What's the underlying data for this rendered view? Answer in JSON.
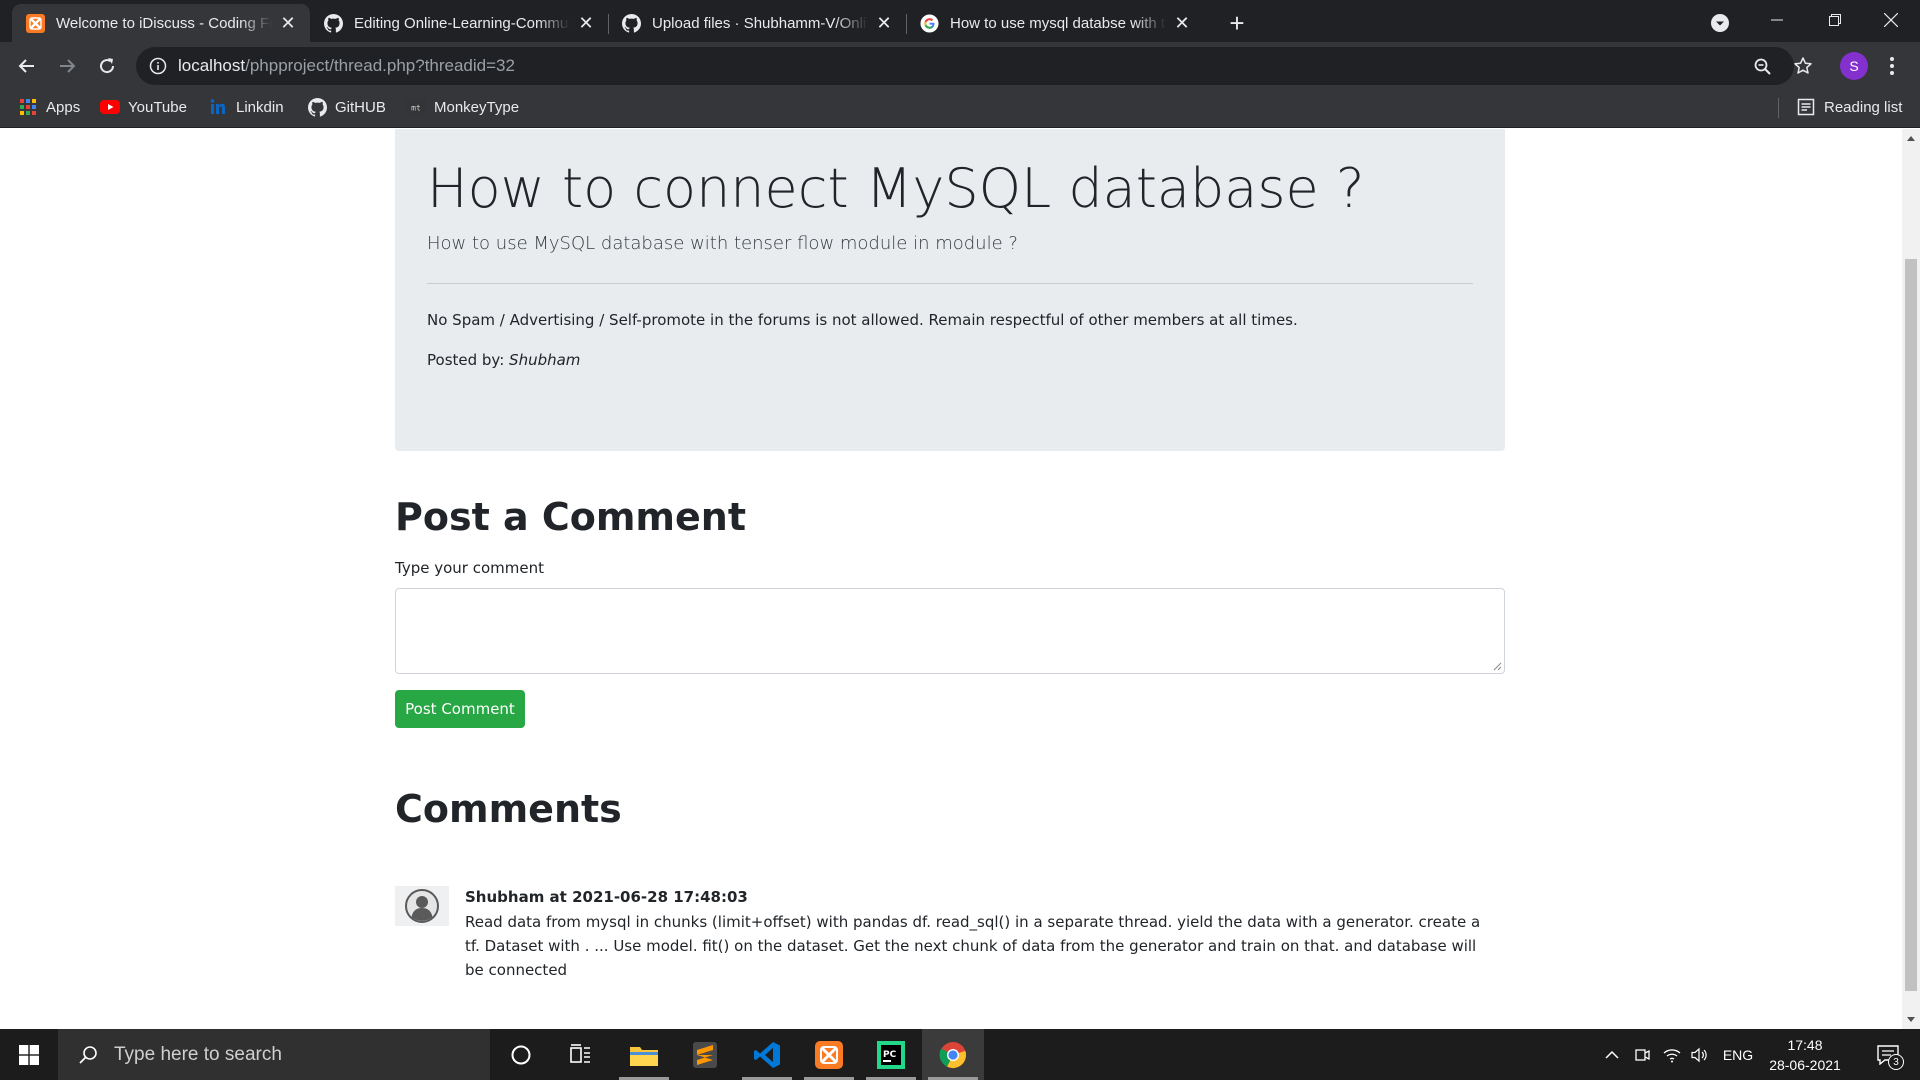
{
  "browser": {
    "tabs": [
      {
        "title": "Welcome to iDiscuss - Coding Forums",
        "favicon": "xampp-icon",
        "active": true
      },
      {
        "title": "Editing Online-Learning-Community",
        "favicon": "github-icon",
        "active": false
      },
      {
        "title": "Upload files · Shubhamm-V/Online",
        "favicon": "github-icon",
        "active": false
      },
      {
        "title": "How to use mysql databse with tensorflow",
        "favicon": "google-icon",
        "active": false
      }
    ],
    "address": {
      "host": "localhost",
      "path": "/phpproject/thread.php?threadid=32"
    },
    "profile_initial": "S",
    "bookmarks": [
      {
        "label": "Apps",
        "icon": "apps-grid-icon"
      },
      {
        "label": "YouTube",
        "icon": "youtube-icon"
      },
      {
        "label": "Linkdin",
        "icon": "linkedin-icon"
      },
      {
        "label": "GitHUB",
        "icon": "github-icon"
      },
      {
        "label": "MonkeyType",
        "icon": "monkeytype-icon"
      }
    ],
    "reading_list": "Reading list"
  },
  "thread": {
    "title": "How to connect MySQL database ?",
    "description": "How to use MySQL database with tenser flow module in module ?",
    "rules": "No Spam / Advertising / Self-promote in the forums is not allowed. Remain respectful of other members at all times.",
    "posted_by_label": "Posted by:",
    "posted_by_user": "Shubham"
  },
  "comment_form": {
    "heading": "Post a Comment",
    "label": "Type your comment",
    "value": "",
    "button": "Post Comment"
  },
  "comments": {
    "heading": "Comments",
    "items": [
      {
        "author_line": "Shubham at 2021-06-28 17:48:03",
        "text": "Read data from mysql in chunks (limit+offset) with pandas df. read_sql() in a separate thread. yield the data with a generator. create a tf. Dataset with . ... Use model. fit() on the dataset. Get the next chunk of data from the generator and train on that. and database will be connected"
      }
    ]
  },
  "taskbar": {
    "search_placeholder": "Type here to search",
    "language": "ENG",
    "time": "17:48",
    "date": "28-06-2021",
    "notification_count": "3"
  },
  "colors": {
    "chrome_dark": "#202124",
    "chrome_toolbar": "#35363a",
    "jumbotron_bg": "#e9ecef",
    "success_green": "#28a745",
    "taskbar": "#1c1c1c"
  }
}
